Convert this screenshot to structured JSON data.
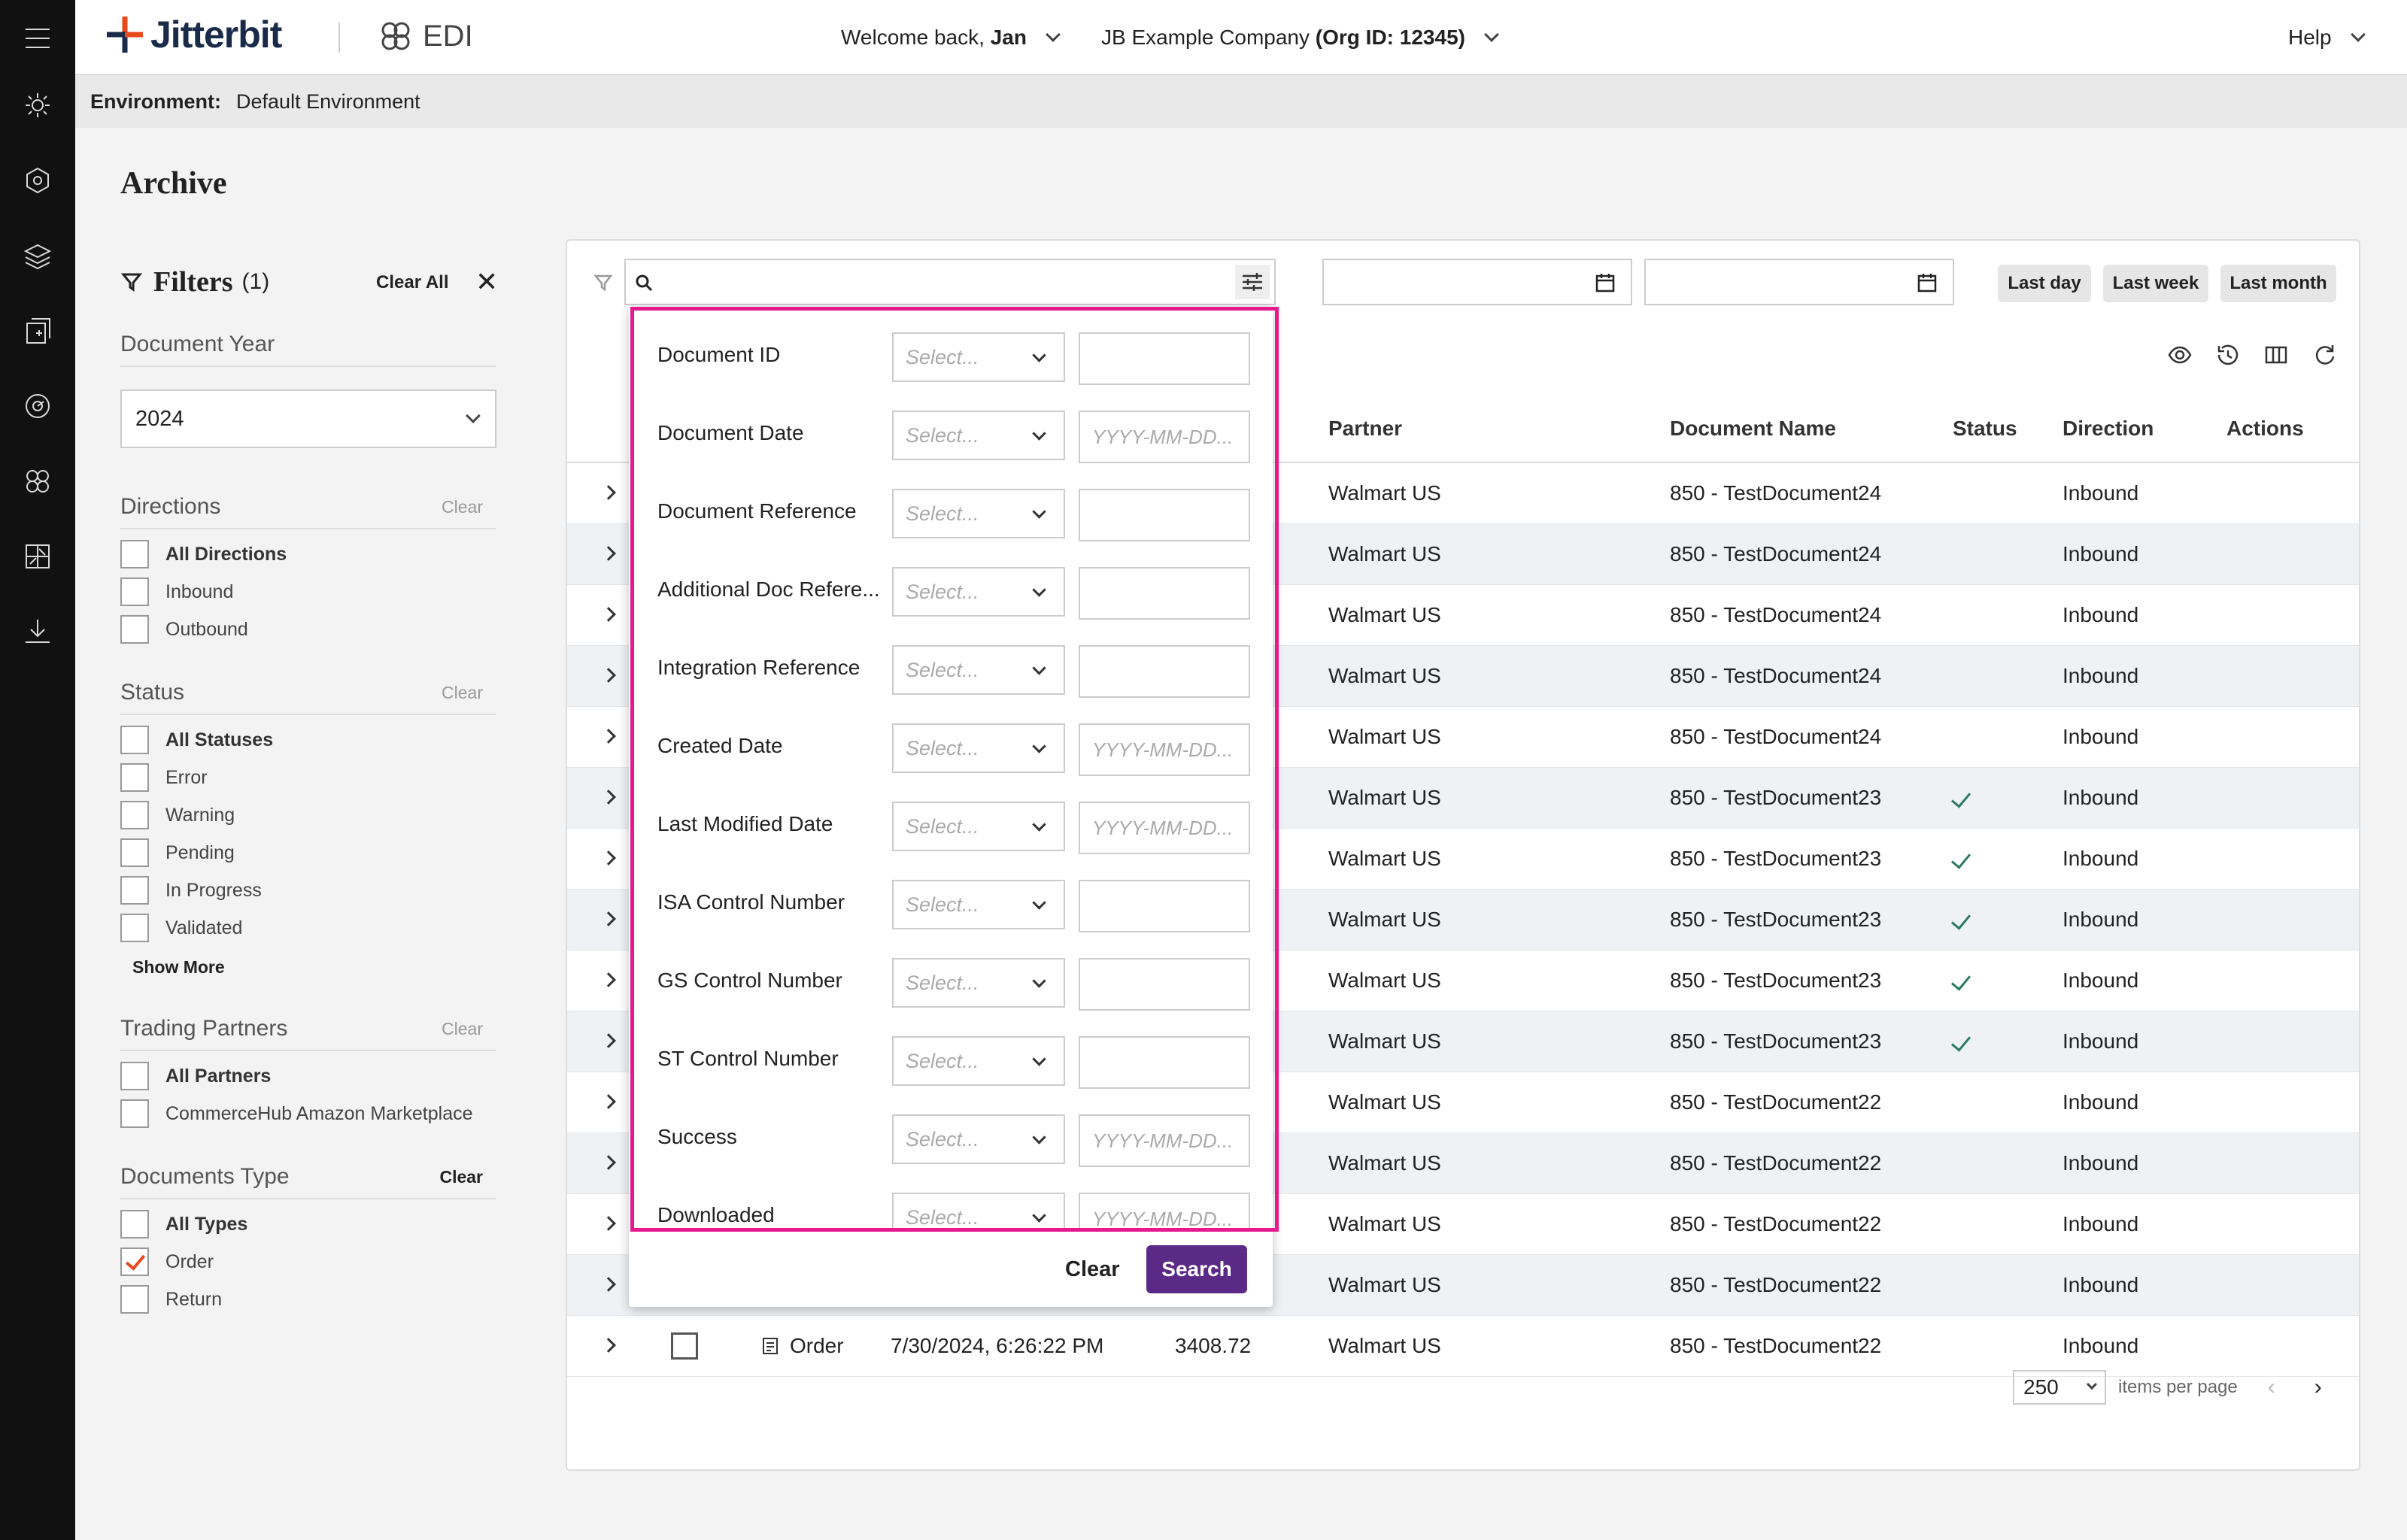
{
  "app": {
    "logo_text": "Jitterbit",
    "product": "EDI"
  },
  "header": {
    "welcome_prefix": "Welcome back,",
    "user": "Jan",
    "company": "JB Example Company",
    "org": "(Org ID: 12345)",
    "help": "Help"
  },
  "environment": {
    "label": "Environment:",
    "value": "Default Environment"
  },
  "page": {
    "title": "Archive"
  },
  "filters": {
    "title": "Filters",
    "count": "(1)",
    "clear_all": "Clear All",
    "document_year": {
      "label": "Document Year",
      "value": "2024"
    },
    "directions": {
      "label": "Directions",
      "clear": "Clear",
      "options": [
        "All Directions",
        "Inbound",
        "Outbound"
      ]
    },
    "status": {
      "label": "Status",
      "clear": "Clear",
      "options": [
        "All Statuses",
        "Error",
        "Warning",
        "Pending",
        "In Progress",
        "Validated"
      ],
      "show_more": "Show More"
    },
    "trading_partners": {
      "label": "Trading Partners",
      "clear": "Clear",
      "options": [
        "All Partners",
        "CommerceHub Amazon Marketplace"
      ]
    },
    "documents_type": {
      "label": "Documents Type",
      "clear": "Clear",
      "options": [
        "All Types",
        "Order",
        "Return"
      ],
      "checked": "Order"
    }
  },
  "quick_range": {
    "last_day": "Last day",
    "last_week": "Last week",
    "last_month": "Last month"
  },
  "table": {
    "headers": {
      "partner": "Partner",
      "document_name": "Document Name",
      "status": "Status",
      "direction": "Direction",
      "actions": "Actions"
    },
    "rows": [
      {
        "partner": "Walmart US",
        "document_name": "850 - TestDocument24",
        "status_ok": false,
        "direction": "Inbound"
      },
      {
        "partner": "Walmart US",
        "document_name": "850 - TestDocument24",
        "status_ok": false,
        "direction": "Inbound"
      },
      {
        "partner": "Walmart US",
        "document_name": "850 - TestDocument24",
        "status_ok": false,
        "direction": "Inbound"
      },
      {
        "partner": "Walmart US",
        "document_name": "850 - TestDocument24",
        "status_ok": false,
        "direction": "Inbound"
      },
      {
        "partner": "Walmart US",
        "document_name": "850 - TestDocument24",
        "status_ok": false,
        "direction": "Inbound"
      },
      {
        "partner": "Walmart US",
        "document_name": "850 - TestDocument23",
        "status_ok": true,
        "direction": "Inbound"
      },
      {
        "partner": "Walmart US",
        "document_name": "850 - TestDocument23",
        "status_ok": true,
        "direction": "Inbound"
      },
      {
        "partner": "Walmart US",
        "document_name": "850 - TestDocument23",
        "status_ok": true,
        "direction": "Inbound"
      },
      {
        "partner": "Walmart US",
        "document_name": "850 - TestDocument23",
        "status_ok": true,
        "direction": "Inbound"
      },
      {
        "partner": "Walmart US",
        "document_name": "850 - TestDocument23",
        "status_ok": true,
        "direction": "Inbound"
      },
      {
        "partner": "Walmart US",
        "document_name": "850 - TestDocument22",
        "status_ok": false,
        "direction": "Inbound"
      },
      {
        "partner": "Walmart US",
        "document_name": "850 - TestDocument22",
        "status_ok": false,
        "direction": "Inbound"
      },
      {
        "partner": "Walmart US",
        "document_name": "850 - TestDocument22",
        "status_ok": false,
        "direction": "Inbound"
      },
      {
        "partner": "Walmart US",
        "document_name": "850 - TestDocument22",
        "status_ok": false,
        "direction": "Inbound"
      }
    ],
    "last_row": {
      "type": "Order",
      "date": "7/30/2024, 6:26:22 PM",
      "amount": "3408.72",
      "partner": "Walmart US",
      "document_name": "850 - TestDocument22",
      "direction": "Inbound"
    }
  },
  "pagination": {
    "per_page": "250",
    "per_page_label": "items per page"
  },
  "advanced_search": {
    "select_placeholder": "Select...",
    "date_placeholder": "YYYY-MM-DD...",
    "fields": [
      {
        "label": "Document ID",
        "kind": "text"
      },
      {
        "label": "Document Date",
        "kind": "date"
      },
      {
        "label": "Document Reference",
        "kind": "text"
      },
      {
        "label": "Additional Doc Refere...",
        "kind": "text"
      },
      {
        "label": "Integration Reference",
        "kind": "text"
      },
      {
        "label": "Created Date",
        "kind": "date"
      },
      {
        "label": "Last Modified Date",
        "kind": "date"
      },
      {
        "label": "ISA Control Number",
        "kind": "text"
      },
      {
        "label": "GS Control Number",
        "kind": "text"
      },
      {
        "label": "ST Control Number",
        "kind": "text"
      },
      {
        "label": "Success",
        "kind": "date"
      },
      {
        "label": "Downloaded",
        "kind": "date"
      }
    ],
    "clear": "Clear",
    "search": "Search"
  },
  "colors": {
    "accent_purple": "#5b2a86",
    "highlight_pink": "#e6198f",
    "logo_orange": "#e8491d",
    "status_green": "#2c7a63"
  }
}
